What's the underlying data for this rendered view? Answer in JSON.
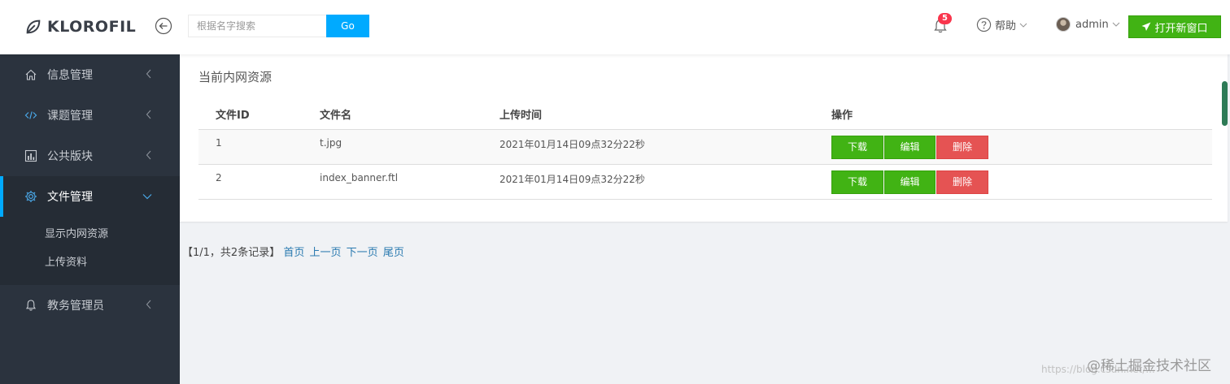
{
  "header": {
    "brand": "KLOROFIL",
    "search": {
      "placeholder": "根据名字搜索",
      "value": "",
      "button_label": "Go"
    },
    "notifications": {
      "count": "5"
    },
    "help_label": "帮助",
    "user_name": "admin",
    "new_window_label": "打开新窗口"
  },
  "sidebar": {
    "items": [
      {
        "label": "信息管理",
        "icon": "home-icon"
      },
      {
        "label": "课题管理",
        "icon": "code-icon"
      },
      {
        "label": "公共版块",
        "icon": "bar-chart-icon"
      },
      {
        "label": "文件管理",
        "icon": "gear-icon",
        "active": true
      },
      {
        "label": "教务管理员",
        "icon": "bell-icon"
      }
    ],
    "submenu": [
      {
        "label": "显示内网资源"
      },
      {
        "label": "上传资料"
      }
    ]
  },
  "main": {
    "title": "当前内网资源",
    "table": {
      "headers": [
        "文件ID",
        "文件名",
        "上传时间",
        "操作"
      ],
      "rows": [
        {
          "id": "1",
          "name": "t.jpg",
          "time": "2021年01月14日09点32分22秒"
        },
        {
          "id": "2",
          "name": "index_banner.ftl",
          "time": "2021年01月14日09点32分22秒"
        }
      ],
      "actions": {
        "download": "下载",
        "edit": "编辑",
        "delete": "删除"
      }
    },
    "pagination": {
      "summary": "【1/1，共2条记录】",
      "first": "首页",
      "prev": "上一页",
      "next": "下一页",
      "last": "尾页"
    }
  },
  "watermark": {
    "url": "https://blog.csdn.net/...",
    "brand": "@稀土掘金技术社区"
  },
  "colors": {
    "accent_blue": "#00aaff",
    "green": "#41b314",
    "red": "#e55353",
    "sidebar_bg": "#2b333e",
    "badge": "#f9354c"
  }
}
